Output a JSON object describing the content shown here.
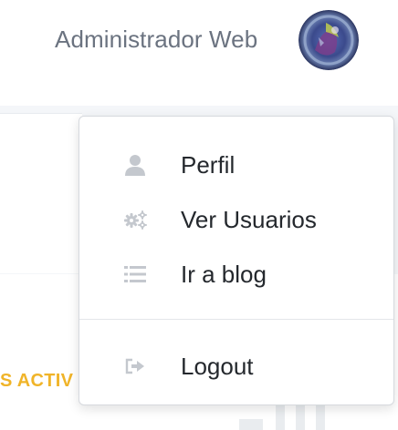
{
  "header": {
    "user_name": "Administrador Web",
    "avatar_icon": "user-avatar"
  },
  "background": {
    "partial_label": "S ACTIV"
  },
  "dropdown": {
    "items": [
      {
        "label": "Perfil",
        "icon": "user-icon"
      },
      {
        "label": "Ver Usuarios",
        "icon": "cogs-icon"
      },
      {
        "label": "Ir a blog",
        "icon": "list-icon"
      }
    ],
    "logout": {
      "label": "Logout",
      "icon": "sign-out-icon"
    }
  },
  "colors": {
    "text": "#24282d",
    "muted": "#6b7380",
    "icon": "#c0c4ca",
    "accent": "#f0b429"
  }
}
